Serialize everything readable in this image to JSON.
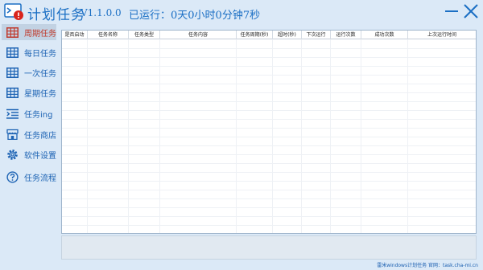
{
  "app": {
    "title": "计划任务",
    "version": "V1.1.0.0",
    "runtime": "已运行：0天0小时0分钟7秒",
    "icon": "terminal-alert-icon"
  },
  "colors": {
    "background": "#dbe9f7",
    "accent": "#1b6fc4",
    "active_label": "#c0392b",
    "alert_badge": "#d9241c"
  },
  "sidebar": {
    "items": [
      {
        "label": "周期任务",
        "icon": "table-grid-icon",
        "active": true
      },
      {
        "label": "每日任务",
        "icon": "table-grid-icon",
        "active": false
      },
      {
        "label": "一次任务",
        "icon": "table-grid-icon",
        "active": false
      },
      {
        "label": "星期任务",
        "icon": "table-grid-icon",
        "active": false
      },
      {
        "label": "任务ing",
        "icon": "list-indent-icon",
        "active": false
      },
      {
        "label": "任务商店",
        "icon": "store-icon",
        "active": false
      },
      {
        "label": "软件设置",
        "icon": "gear-icon",
        "active": false
      },
      {
        "label": "任务流程",
        "icon": "question-circle-icon",
        "active": false
      }
    ]
  },
  "grid": {
    "columns": [
      "是否启动",
      "任务名称",
      "任务类型",
      "任务内容",
      "任务周期(秒)",
      "超时(秒)",
      "下次运行",
      "运行次数",
      "成功次数",
      "上次运行时间"
    ],
    "rows": []
  },
  "footer": {
    "text": "雷米windows计划任务 官网：task.cha-mi.cn"
  }
}
